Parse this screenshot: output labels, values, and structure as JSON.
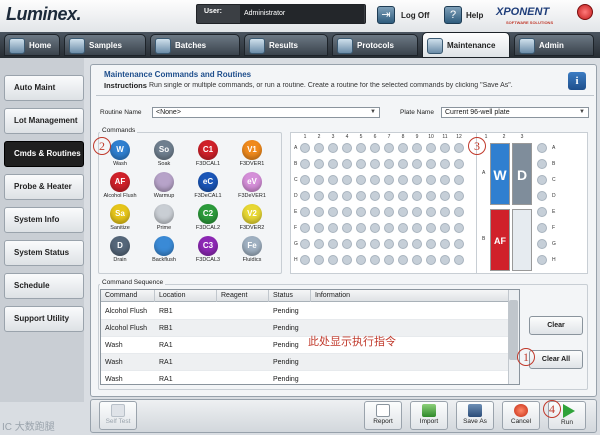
{
  "header": {
    "logo": "Luminex.",
    "user_label": "User:",
    "user_value": "Administrator",
    "logoff_label": "Log Off",
    "help_label": "Help",
    "brand": "XPONENT",
    "brand_sub": "SOFTWARE SOLUTIONS"
  },
  "tabs": [
    {
      "label": "Home"
    },
    {
      "label": "Samples"
    },
    {
      "label": "Batches"
    },
    {
      "label": "Results"
    },
    {
      "label": "Protocols"
    },
    {
      "label": "Maintenance"
    },
    {
      "label": "Admin"
    }
  ],
  "sidebar": {
    "items": [
      {
        "label": "Auto Maint"
      },
      {
        "label": "Lot Management"
      },
      {
        "label": "Cmds & Routines"
      },
      {
        "label": "Probe & Heater"
      },
      {
        "label": "System Info"
      },
      {
        "label": "System Status"
      },
      {
        "label": "Schedule"
      },
      {
        "label": "Support Utility"
      }
    ],
    "active": "Cmds & Routines"
  },
  "panel": {
    "title": "Maintenance Commands and Routines",
    "instructions_label": "Instructions",
    "instructions_text": "Run single or multiple commands, or run a routine. Create a routine for the selected commands by clicking \"Save As\".",
    "routine_name_label": "Routine Name",
    "routine_name_value": "<None>",
    "plate_name_label": "Plate Name",
    "plate_name_value": "Current 96-well plate",
    "commands_label": "Commands",
    "sequence_label": "Command Sequence"
  },
  "commands": [
    {
      "code": "W",
      "label": "Wash",
      "color": "#2f7fd0"
    },
    {
      "code": "So",
      "label": "Soak",
      "color": "#6f7f8f"
    },
    {
      "code": "C1",
      "label": "F3DCAL1",
      "color": "#d0212a"
    },
    {
      "code": "V1",
      "label": "F3DVER1",
      "color": "#f08a1c"
    },
    {
      "code": "AF",
      "label": "Alcohol Flush",
      "color": "#d0212a"
    },
    {
      "code": "",
      "label": "Warmup",
      "color": "#b7a3c9"
    },
    {
      "code": "eC",
      "label": "F3DeCAL1",
      "color": "#1a56b8"
    },
    {
      "code": "eV",
      "label": "F3DeVER1",
      "color": "#d58fd9"
    },
    {
      "code": "Sa",
      "label": "Sanitize",
      "color": "#e6c51a"
    },
    {
      "code": "",
      "label": "Prime",
      "color": "#c9ced4"
    },
    {
      "code": "C2",
      "label": "F3DCAL2",
      "color": "#2c9b3b"
    },
    {
      "code": "V2",
      "label": "F3DVER2",
      "color": "#e8d834"
    },
    {
      "code": "D",
      "label": "Drain",
      "color": "#55677a"
    },
    {
      "code": "",
      "label": "Backflush",
      "color": "#3a8ad6"
    },
    {
      "code": "C3",
      "label": "F3DCAL3",
      "color": "#8d28b5"
    },
    {
      "code": "Fe",
      "label": "Fluidics",
      "color": "#9fb0c1"
    }
  ],
  "plate": {
    "columns": [
      "1",
      "2",
      "3",
      "4",
      "5",
      "6",
      "7",
      "8",
      "9",
      "10",
      "11",
      "12"
    ],
    "rows": [
      "A",
      "B",
      "C",
      "D",
      "E",
      "F",
      "G",
      "H"
    ],
    "reservoir_columns": [
      "1",
      "2",
      "3"
    ],
    "reservoir_rows": [
      "A",
      "B"
    ],
    "troughs": [
      {
        "code": "W",
        "color": "#2f7fd0"
      },
      {
        "code": "D",
        "color": "#7f8d9b"
      },
      {
        "code": "AF",
        "color": "#d0212a"
      },
      {
        "code": "",
        "color": "#e6ebf0"
      }
    ]
  },
  "sequence": {
    "columns": [
      "Command",
      "Location",
      "Reagent",
      "Status",
      "Information"
    ],
    "rows": [
      {
        "command": "Alcohol Flush",
        "location": "RB1",
        "reagent": "",
        "status": "Pending",
        "information": ""
      },
      {
        "command": "Alcohol Flush",
        "location": "RB1",
        "reagent": "",
        "status": "Pending",
        "information": ""
      },
      {
        "command": "Wash",
        "location": "RA1",
        "reagent": "",
        "status": "Pending",
        "information": ""
      },
      {
        "command": "Wash",
        "location": "RA1",
        "reagent": "",
        "status": "Pending",
        "information": ""
      },
      {
        "command": "Wash",
        "location": "RA1",
        "reagent": "",
        "status": "Pending",
        "information": ""
      }
    ],
    "clear_label": "Clear",
    "clear_all_label": "Clear All"
  },
  "annotation_text": "此处显示执行指令",
  "annotations": [
    "2",
    "3",
    "1",
    "4"
  ],
  "bottom": {
    "self_test": "Self Test",
    "report": "Report",
    "import": "Import",
    "save_as": "Save As",
    "cancel": "Cancel",
    "run": "Run"
  },
  "watermark": "IC 大数跑腿"
}
